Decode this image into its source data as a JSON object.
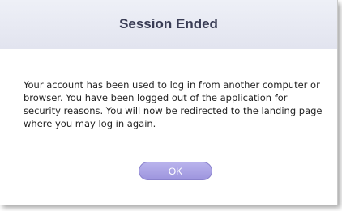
{
  "dialog": {
    "title": "Session Ended",
    "message": "Your account has been used to log in from another computer or browser. You have been logged out of the application for security reasons. You will now be redirected to the landing page where you may log in again.",
    "ok_label": "OK"
  },
  "colors": {
    "header_background": "#e6e8f2",
    "title_text": "#3a3d55",
    "button_background": "#a9a2e4",
    "button_text": "#ffffff"
  }
}
